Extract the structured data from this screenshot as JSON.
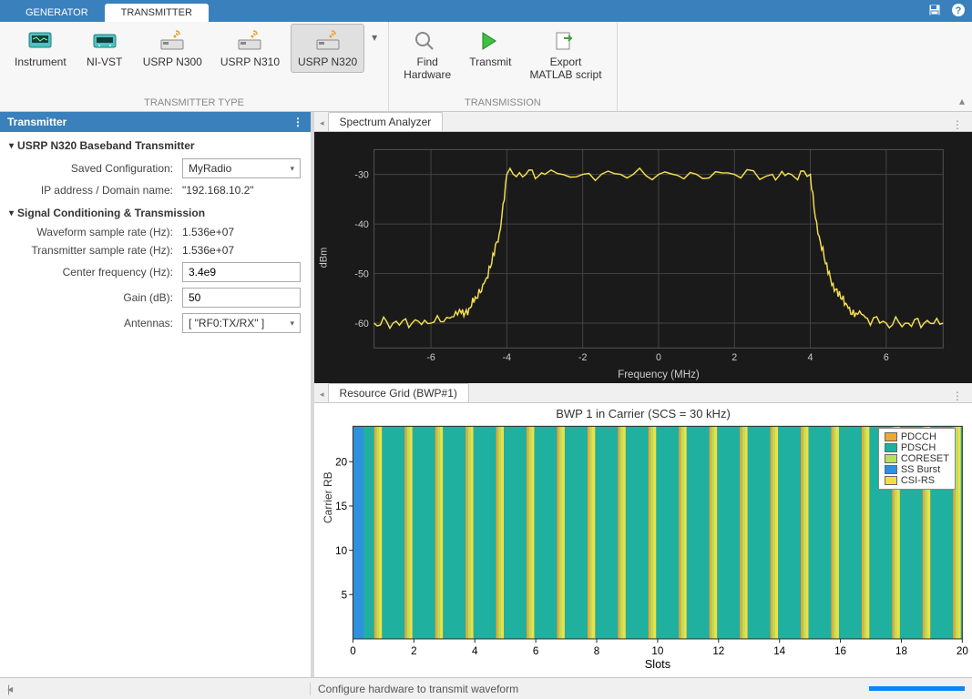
{
  "tabs": {
    "generator": "GENERATOR",
    "transmitter": "TRANSMITTER"
  },
  "ribbon": {
    "type_group": "TRANSMITTER TYPE",
    "transmission_group": "TRANSMISSION",
    "instrument": "Instrument",
    "nivst": "NI-VST",
    "n300": "USRP N300",
    "n310": "USRP N310",
    "n320": "USRP N320",
    "find": "Find\nHardware",
    "transmit": "Transmit",
    "export": "Export\nMATLAB script"
  },
  "panel": {
    "title": "Transmitter",
    "section1": "USRP N320 Baseband Transmitter",
    "section2": "Signal Conditioning & Transmission",
    "saved_cfg_lbl": "Saved Configuration:",
    "saved_cfg_val": "MyRadio",
    "ip_lbl": "IP address / Domain name:",
    "ip_val": "\"192.168.10.2\"",
    "wf_rate_lbl": "Waveform sample rate (Hz):",
    "wf_rate_val": "1.536e+07",
    "tx_rate_lbl": "Transmitter sample rate (Hz):",
    "tx_rate_val": "1.536e+07",
    "cf_lbl": "Center frequency (Hz):",
    "cf_val": "3.4e9",
    "gain_lbl": "Gain (dB):",
    "gain_val": "50",
    "ant_lbl": "Antennas:",
    "ant_val": "[ \"RF0:TX/RX\" ]"
  },
  "subtabs": {
    "spectrum": "Spectrum Analyzer",
    "resource": "Resource Grid (BWP#1)"
  },
  "status": "Configure hardware to transmit waveform",
  "chart_data": [
    {
      "type": "line",
      "title": "",
      "xlabel": "Frequency (MHz)",
      "ylabel": "dBm",
      "xlim": [
        -7.5,
        7.5
      ],
      "ylim": [
        -65,
        -25
      ],
      "xticks": [
        -6,
        -4,
        -2,
        0,
        2,
        4,
        6
      ],
      "yticks": [
        -30,
        -40,
        -50,
        -60
      ],
      "series": [
        {
          "name": "spectrum",
          "x": [
            -7.5,
            -7,
            -6.5,
            -6,
            -5.5,
            -5.2,
            -5,
            -4.8,
            -4.6,
            -4.4,
            -4.2,
            -4,
            -3.5,
            -3,
            -2,
            -1,
            0,
            1,
            2,
            3,
            3.5,
            4,
            4.2,
            4.4,
            4.6,
            4.8,
            5,
            5.2,
            5.5,
            6,
            6.5,
            7,
            7.5
          ],
          "y": [
            -60,
            -60,
            -60,
            -60,
            -59,
            -58,
            -57,
            -55,
            -52,
            -48,
            -42,
            -30,
            -30,
            -30,
            -30,
            -30,
            -30,
            -30,
            -30,
            -30,
            -30,
            -30,
            -42,
            -48,
            -52,
            -55,
            -57,
            -58,
            -59,
            -60,
            -60,
            -60,
            -60
          ]
        }
      ]
    },
    {
      "type": "heatmap",
      "title": "BWP 1 in Carrier (SCS = 30 kHz)",
      "xlabel": "Slots",
      "ylabel": "Carrier RB",
      "xlim": [
        0,
        20
      ],
      "ylim": [
        0,
        24
      ],
      "xticks": [
        0,
        2,
        4,
        6,
        8,
        10,
        12,
        14,
        16,
        18,
        20
      ],
      "yticks": [
        5,
        10,
        15,
        20
      ],
      "legend": [
        {
          "name": "PDCCH",
          "color": "#f0a830"
        },
        {
          "name": "PDSCH",
          "color": "#20b0a0"
        },
        {
          "name": "CORESET",
          "color": "#b8e060"
        },
        {
          "name": "SS Burst",
          "color": "#3090e0"
        },
        {
          "name": "CSI-RS",
          "color": "#f0e040"
        }
      ],
      "note": "Background PDSCH (teal) over full grid; SS Burst column at slot 0; narrow PDCCH/CORESET/CSI-RS stripes each slot"
    }
  ]
}
